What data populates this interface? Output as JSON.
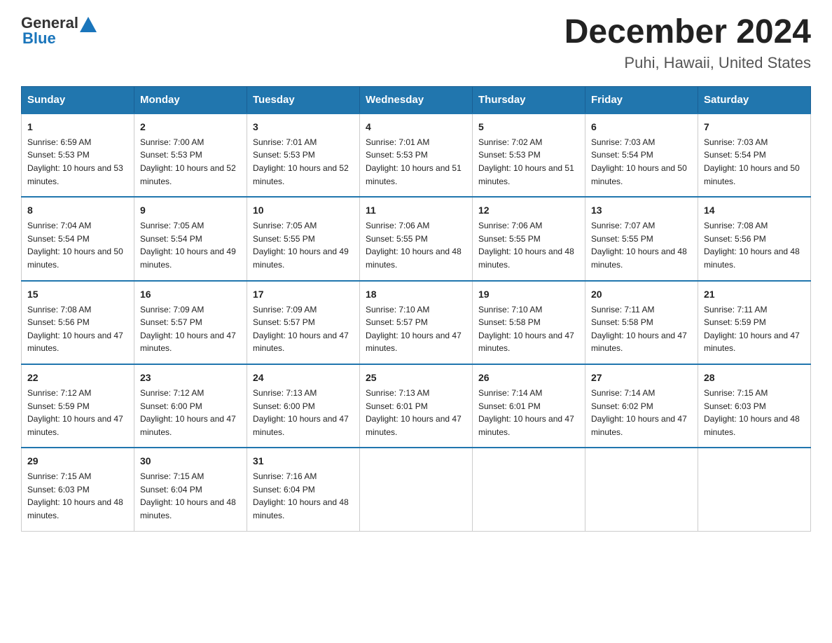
{
  "header": {
    "logo_general": "General",
    "logo_blue": "Blue",
    "title": "December 2024",
    "subtitle": "Puhi, Hawaii, United States"
  },
  "columns": [
    "Sunday",
    "Monday",
    "Tuesday",
    "Wednesday",
    "Thursday",
    "Friday",
    "Saturday"
  ],
  "weeks": [
    [
      {
        "day": "1",
        "sunrise": "Sunrise: 6:59 AM",
        "sunset": "Sunset: 5:53 PM",
        "daylight": "Daylight: 10 hours and 53 minutes."
      },
      {
        "day": "2",
        "sunrise": "Sunrise: 7:00 AM",
        "sunset": "Sunset: 5:53 PM",
        "daylight": "Daylight: 10 hours and 52 minutes."
      },
      {
        "day": "3",
        "sunrise": "Sunrise: 7:01 AM",
        "sunset": "Sunset: 5:53 PM",
        "daylight": "Daylight: 10 hours and 52 minutes."
      },
      {
        "day": "4",
        "sunrise": "Sunrise: 7:01 AM",
        "sunset": "Sunset: 5:53 PM",
        "daylight": "Daylight: 10 hours and 51 minutes."
      },
      {
        "day": "5",
        "sunrise": "Sunrise: 7:02 AM",
        "sunset": "Sunset: 5:53 PM",
        "daylight": "Daylight: 10 hours and 51 minutes."
      },
      {
        "day": "6",
        "sunrise": "Sunrise: 7:03 AM",
        "sunset": "Sunset: 5:54 PM",
        "daylight": "Daylight: 10 hours and 50 minutes."
      },
      {
        "day": "7",
        "sunrise": "Sunrise: 7:03 AM",
        "sunset": "Sunset: 5:54 PM",
        "daylight": "Daylight: 10 hours and 50 minutes."
      }
    ],
    [
      {
        "day": "8",
        "sunrise": "Sunrise: 7:04 AM",
        "sunset": "Sunset: 5:54 PM",
        "daylight": "Daylight: 10 hours and 50 minutes."
      },
      {
        "day": "9",
        "sunrise": "Sunrise: 7:05 AM",
        "sunset": "Sunset: 5:54 PM",
        "daylight": "Daylight: 10 hours and 49 minutes."
      },
      {
        "day": "10",
        "sunrise": "Sunrise: 7:05 AM",
        "sunset": "Sunset: 5:55 PM",
        "daylight": "Daylight: 10 hours and 49 minutes."
      },
      {
        "day": "11",
        "sunrise": "Sunrise: 7:06 AM",
        "sunset": "Sunset: 5:55 PM",
        "daylight": "Daylight: 10 hours and 48 minutes."
      },
      {
        "day": "12",
        "sunrise": "Sunrise: 7:06 AM",
        "sunset": "Sunset: 5:55 PM",
        "daylight": "Daylight: 10 hours and 48 minutes."
      },
      {
        "day": "13",
        "sunrise": "Sunrise: 7:07 AM",
        "sunset": "Sunset: 5:55 PM",
        "daylight": "Daylight: 10 hours and 48 minutes."
      },
      {
        "day": "14",
        "sunrise": "Sunrise: 7:08 AM",
        "sunset": "Sunset: 5:56 PM",
        "daylight": "Daylight: 10 hours and 48 minutes."
      }
    ],
    [
      {
        "day": "15",
        "sunrise": "Sunrise: 7:08 AM",
        "sunset": "Sunset: 5:56 PM",
        "daylight": "Daylight: 10 hours and 47 minutes."
      },
      {
        "day": "16",
        "sunrise": "Sunrise: 7:09 AM",
        "sunset": "Sunset: 5:57 PM",
        "daylight": "Daylight: 10 hours and 47 minutes."
      },
      {
        "day": "17",
        "sunrise": "Sunrise: 7:09 AM",
        "sunset": "Sunset: 5:57 PM",
        "daylight": "Daylight: 10 hours and 47 minutes."
      },
      {
        "day": "18",
        "sunrise": "Sunrise: 7:10 AM",
        "sunset": "Sunset: 5:57 PM",
        "daylight": "Daylight: 10 hours and 47 minutes."
      },
      {
        "day": "19",
        "sunrise": "Sunrise: 7:10 AM",
        "sunset": "Sunset: 5:58 PM",
        "daylight": "Daylight: 10 hours and 47 minutes."
      },
      {
        "day": "20",
        "sunrise": "Sunrise: 7:11 AM",
        "sunset": "Sunset: 5:58 PM",
        "daylight": "Daylight: 10 hours and 47 minutes."
      },
      {
        "day": "21",
        "sunrise": "Sunrise: 7:11 AM",
        "sunset": "Sunset: 5:59 PM",
        "daylight": "Daylight: 10 hours and 47 minutes."
      }
    ],
    [
      {
        "day": "22",
        "sunrise": "Sunrise: 7:12 AM",
        "sunset": "Sunset: 5:59 PM",
        "daylight": "Daylight: 10 hours and 47 minutes."
      },
      {
        "day": "23",
        "sunrise": "Sunrise: 7:12 AM",
        "sunset": "Sunset: 6:00 PM",
        "daylight": "Daylight: 10 hours and 47 minutes."
      },
      {
        "day": "24",
        "sunrise": "Sunrise: 7:13 AM",
        "sunset": "Sunset: 6:00 PM",
        "daylight": "Daylight: 10 hours and 47 minutes."
      },
      {
        "day": "25",
        "sunrise": "Sunrise: 7:13 AM",
        "sunset": "Sunset: 6:01 PM",
        "daylight": "Daylight: 10 hours and 47 minutes."
      },
      {
        "day": "26",
        "sunrise": "Sunrise: 7:14 AM",
        "sunset": "Sunset: 6:01 PM",
        "daylight": "Daylight: 10 hours and 47 minutes."
      },
      {
        "day": "27",
        "sunrise": "Sunrise: 7:14 AM",
        "sunset": "Sunset: 6:02 PM",
        "daylight": "Daylight: 10 hours and 47 minutes."
      },
      {
        "day": "28",
        "sunrise": "Sunrise: 7:15 AM",
        "sunset": "Sunset: 6:03 PM",
        "daylight": "Daylight: 10 hours and 48 minutes."
      }
    ],
    [
      {
        "day": "29",
        "sunrise": "Sunrise: 7:15 AM",
        "sunset": "Sunset: 6:03 PM",
        "daylight": "Daylight: 10 hours and 48 minutes."
      },
      {
        "day": "30",
        "sunrise": "Sunrise: 7:15 AM",
        "sunset": "Sunset: 6:04 PM",
        "daylight": "Daylight: 10 hours and 48 minutes."
      },
      {
        "day": "31",
        "sunrise": "Sunrise: 7:16 AM",
        "sunset": "Sunset: 6:04 PM",
        "daylight": "Daylight: 10 hours and 48 minutes."
      },
      null,
      null,
      null,
      null
    ]
  ]
}
